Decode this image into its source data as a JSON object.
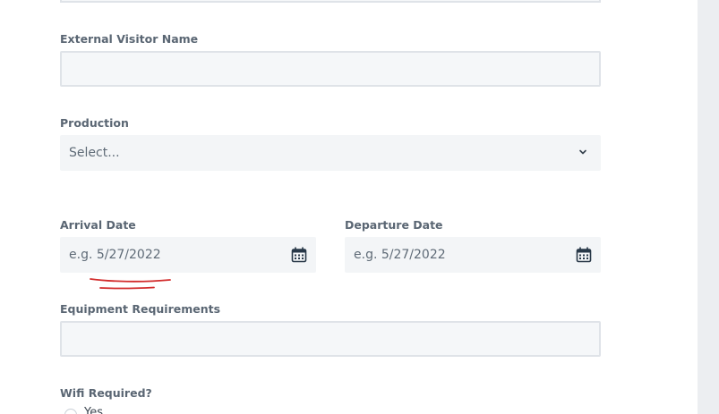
{
  "form": {
    "external_visitor_name": {
      "label": "External Visitor Name",
      "value": ""
    },
    "production": {
      "label": "Production",
      "selected": "Select..."
    },
    "arrival_date": {
      "label": "Arrival Date",
      "placeholder": "e.g. 5/27/2022"
    },
    "departure_date": {
      "label": "Departure Date",
      "placeholder": "e.g. 5/27/2022"
    },
    "equipment_requirements": {
      "label": "Equipment Requirements",
      "value": ""
    },
    "wifi_required": {
      "label": "Wifi Required?",
      "first_option_label": "Yes"
    }
  },
  "icons": {
    "dropdown": "chevron-down-icon",
    "date_picker": "calendar-icon"
  },
  "colors": {
    "label_text": "#5a6673",
    "field_background": "#f5f7f9",
    "field_border": "#dfe3e8",
    "placeholder_text": "#5f6b77",
    "icon": "#283848",
    "annotation": "#d22b2b"
  }
}
